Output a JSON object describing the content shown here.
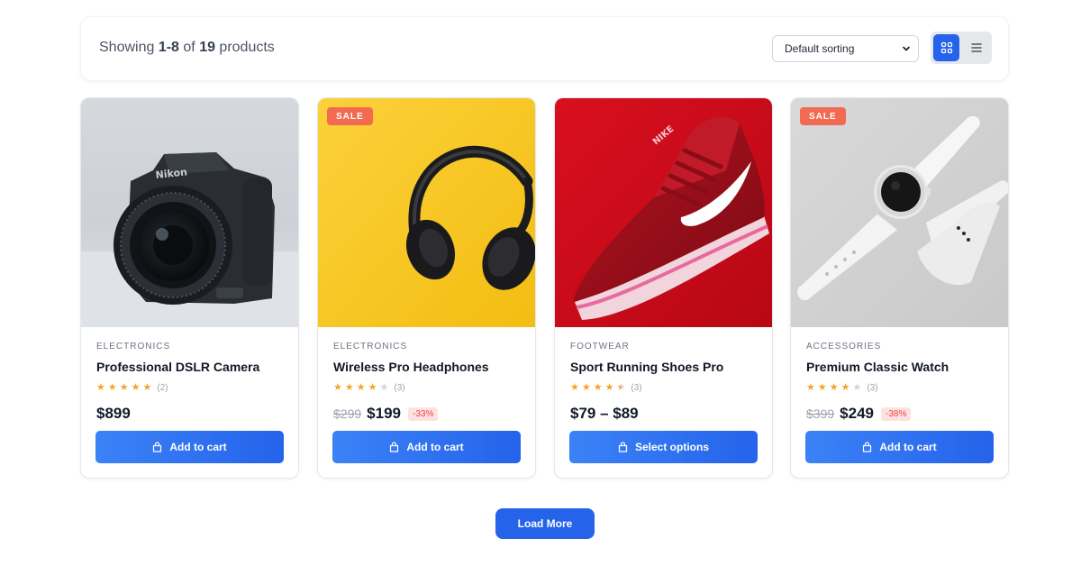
{
  "toolbar": {
    "showing_prefix": "Showing ",
    "range": "1-8",
    "of": " of ",
    "total": "19",
    "suffix": " products",
    "sort_value": "Default sorting",
    "view_modes": [
      "grid-view-icon",
      "list-view-icon"
    ],
    "active_view": "grid"
  },
  "colors": {
    "accent": "#2563eb",
    "sale_badge": "#f36a52",
    "star": "#f5a524",
    "discount_text": "#ef4444"
  },
  "products": [
    {
      "category": "ELECTRONICS",
      "title": "Professional DSLR Camera",
      "rating": 5,
      "rating_count": "(2)",
      "price_old": "",
      "price": "$899",
      "discount": "",
      "sale": false,
      "button": "Add to cart",
      "image": "camera-image"
    },
    {
      "category": "ELECTRONICS",
      "title": "Wireless Pro Headphones",
      "rating": 4,
      "rating_count": "(3)",
      "price_old": "$299",
      "price": "$199",
      "discount": "-33%",
      "sale": true,
      "sale_label": "SALE",
      "button": "Add to cart",
      "image": "headphones-image"
    },
    {
      "category": "FOOTWEAR",
      "title": "Sport Running Shoes Pro",
      "rating": 4.5,
      "rating_count": "(3)",
      "price_old": "",
      "price": "$79 – $89",
      "discount": "",
      "sale": false,
      "button": "Select options",
      "image": "running-shoe-image"
    },
    {
      "category": "ACCESSORIES",
      "title": "Premium Classic Watch",
      "rating": 4,
      "rating_count": "(3)",
      "price_old": "$399",
      "price": "$249",
      "discount": "-38%",
      "sale": true,
      "sale_label": "SALE",
      "button": "Add to cart",
      "image": "watch-image"
    }
  ],
  "load_more": "Load More"
}
